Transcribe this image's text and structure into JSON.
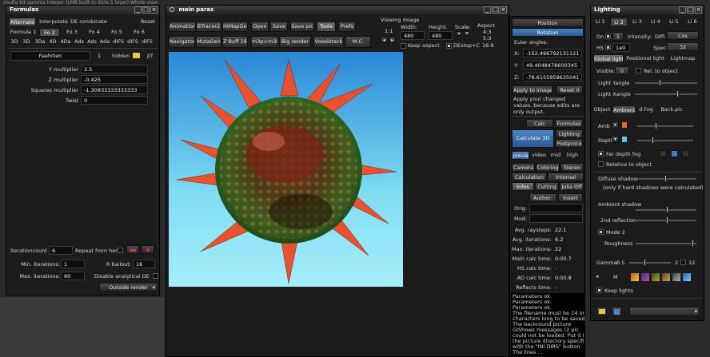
{
  "background_line": "config bit gamma integer (LMB built-in dicts 1 layer)     Whole view",
  "colors": {
    "accent": "#3d7fc7",
    "sky_top": "#2e8fd8",
    "sky_bottom": "#8fe4f4",
    "swatch_orange": "#e07020",
    "swatch_cyan": "#4fd0f0"
  },
  "formulas": {
    "title": "Formulas",
    "row1": [
      "Alternate",
      "Interpolate",
      "DE combinate",
      "Reset"
    ],
    "row2": [
      "Formula 1",
      "Fo 2",
      "Fo 3",
      "Fo 4",
      "Fo 5",
      "Fo 6"
    ],
    "row3": [
      "3D",
      "3D",
      "3Da",
      "4D",
      "4Da",
      "Ads",
      "Ads",
      "Ada",
      "dIFS",
      "dIFS",
      "dIFS"
    ],
    "formula_name": "Faehrten",
    "formula_number": "1",
    "hidden_label": "hidden",
    "jit_label": "JIT",
    "params": [
      {
        "label": "Y multiplier",
        "value": "2.5"
      },
      {
        "label": "Z multiplier",
        "value": "-0.425"
      },
      {
        "label": "Squares multiplier",
        "value": "-1.30833333333333"
      },
      {
        "label": "Twist",
        "value": "0"
      }
    ],
    "iteration_count_label": "Iterationcount",
    "iteration_count": "6",
    "repeat_label": "Repeat from here",
    "min_iter_label": "Min. iterations:",
    "min_iter": "1",
    "max_iter_label": "Max. iterations:",
    "max_iter": "60",
    "bailout_label": "R bailout:",
    "bailout": "16",
    "disable_de_label": "Disable analytical DE",
    "outside_render": "Outside render"
  },
  "main": {
    "title": "main paras",
    "row1": [
      "Animations",
      "BTracer2",
      "HiMapGen",
      "Open",
      "Save",
      "Save pic",
      "Tools",
      "Prefs"
    ],
    "row2": [
      "Navigator",
      "MutaGen",
      "Z Buff 16bit",
      "m3p>m3i",
      "Big render",
      "Voxelstack",
      "M.C."
    ],
    "viewing_label": "Viewing",
    "viewing_ratio": "1:1",
    "image_label": "Image",
    "width_label": "Width:",
    "width": "480",
    "height_label": "Height:",
    "height": "480",
    "scale_label": "Scale:",
    "aspect_label": "Aspect",
    "aspects": [
      "4:3",
      "5:3",
      "16:9"
    ],
    "keep_aspect_label": "Keep aspect",
    "de_stop_label": "DEstop+C"
  },
  "position_panel": {
    "position_label": "Position",
    "rotation_label": "Rotation",
    "euler_label": "Euler angles:",
    "x": "-152.496792131121",
    "y": "49.4048478600345",
    "z": "-78.6155959635041",
    "apply_label": "Apply to image",
    "reset_label": "Reset 0",
    "note": "Apply your changed values, because edits are only output.",
    "calc_label": "Calc",
    "formulas_label": "Formulas",
    "lighting_label": "Lighting",
    "postprocess_label": "Postprocess",
    "calculate_label": "Calculate 3D",
    "quality": [
      "preview",
      "video",
      "mid",
      "high"
    ],
    "tabs1": [
      "Camera",
      "Coloring",
      "Stereo"
    ],
    "tabs2": [
      "Calculation",
      "Internal"
    ],
    "tabs3": [
      "Infos",
      "Cutting",
      "Julia Off"
    ],
    "author_label": "Author:",
    "insert_label": "insert",
    "orig_label": "Orig:",
    "mod_label": "Mod:",
    "stats": [
      {
        "label": "Avg. raysteps:",
        "value": "22.1"
      },
      {
        "label": "Avg. iterations:",
        "value": "6.2"
      },
      {
        "label": "Max. iterations:",
        "value": "22"
      },
      {
        "label": "Main calc time:",
        "value": "0:00.7"
      },
      {
        "label": "HS calc time:",
        "value": "-"
      },
      {
        "label": "AO calc time:",
        "value": "0:00.8"
      },
      {
        "label": "Reflects time:",
        "value": "-"
      }
    ],
    "log": [
      "Parameters ok.",
      "Parameters ok.",
      "Parameters ok.",
      "The filename must be 24 or less",
      "characters long to be saved.",
      "The backround picture",
      "GIShows messages (2 pic",
      "could not be loaded. Put it in",
      "the picture directory specified",
      "with the \"INI DIRS\" button.",
      "The lines ..."
    ]
  },
  "lighting": {
    "title": "Lighting",
    "lights": [
      "Li 1",
      "Li 2",
      "Li 3",
      "Li 4",
      "Li 5",
      "Li 6"
    ],
    "on_label": "On",
    "hs_label": "HS",
    "light_num": "1",
    "intensity_label": "Intensity:",
    "diff_label": "Diff:",
    "diff_value": "Cos",
    "spec_label": "Spec:",
    "spec_value": "32",
    "hs_value": "1e0",
    "tabs": [
      "Global light",
      "Positional light",
      "Lightmap"
    ],
    "visible_label": "Visible:",
    "visible_value": "0",
    "rel_object_label": "Rel. to object",
    "light_y_label": "Light Yangle",
    "light_x_label": "Light Xangle",
    "tabs2": [
      "Object",
      "Ambient",
      "d.Fog",
      "Back.pic"
    ],
    "amb_label": "Amb",
    "depth_label": "Depth",
    "far_depth_label": "Far depth fog",
    "relative_label": "Relative to object",
    "diffuse_shadow_label": "Diffuse shadow",
    "diffuse_note": "(only if hard shadows were calculated)",
    "ambient_shadow_label": "Ambient shadow",
    "reflection_label": "2nd reflection",
    "mode2_label": "Mode 2",
    "roughness_label": "Roughness",
    "gamma_label": "Gamma:",
    "gamma_value": "0.5",
    "gamma_a": "2",
    "gamma_b": "12",
    "m_label": "M",
    "keep_lights_label": "Keep lights"
  }
}
